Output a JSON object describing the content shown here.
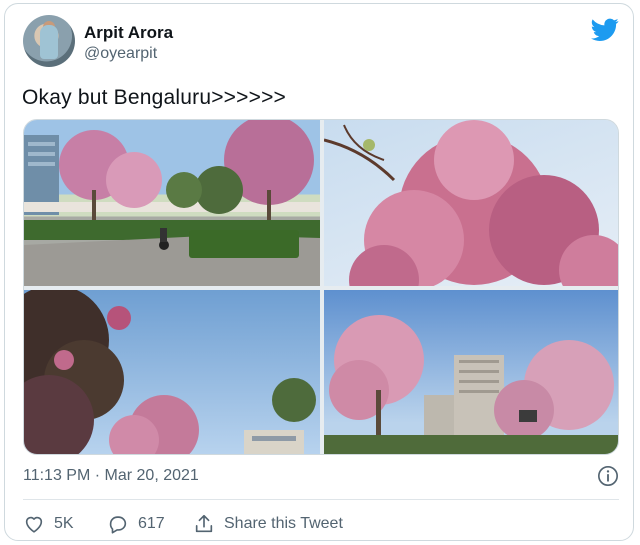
{
  "author": {
    "name": "Arpit Arora",
    "handle": "@oyearpit"
  },
  "tweet": {
    "text": "Okay but Bengaluru>>>>>>",
    "timestamp": "11:13 PM · Mar 20, 2021"
  },
  "media": {
    "photos": [
      {
        "alt_icon": "photo-pink-trees-street"
      },
      {
        "alt_icon": "photo-pink-blossom-closeup"
      },
      {
        "alt_icon": "photo-pink-blossom-sky"
      },
      {
        "alt_icon": "photo-pink-trees-buildings"
      }
    ]
  },
  "actions": {
    "likes": "5K",
    "replies": "617",
    "share_label": "Share this Tweet"
  },
  "colors": {
    "brand": "#1d9bf0",
    "text": "#0f1419",
    "secondary": "#536471",
    "border": "#cfd9de"
  },
  "icons": {
    "brand": "twitter-bird-icon",
    "info": "info-icon",
    "like": "heart-icon",
    "reply": "reply-bubble-icon",
    "share": "share-upload-icon"
  }
}
